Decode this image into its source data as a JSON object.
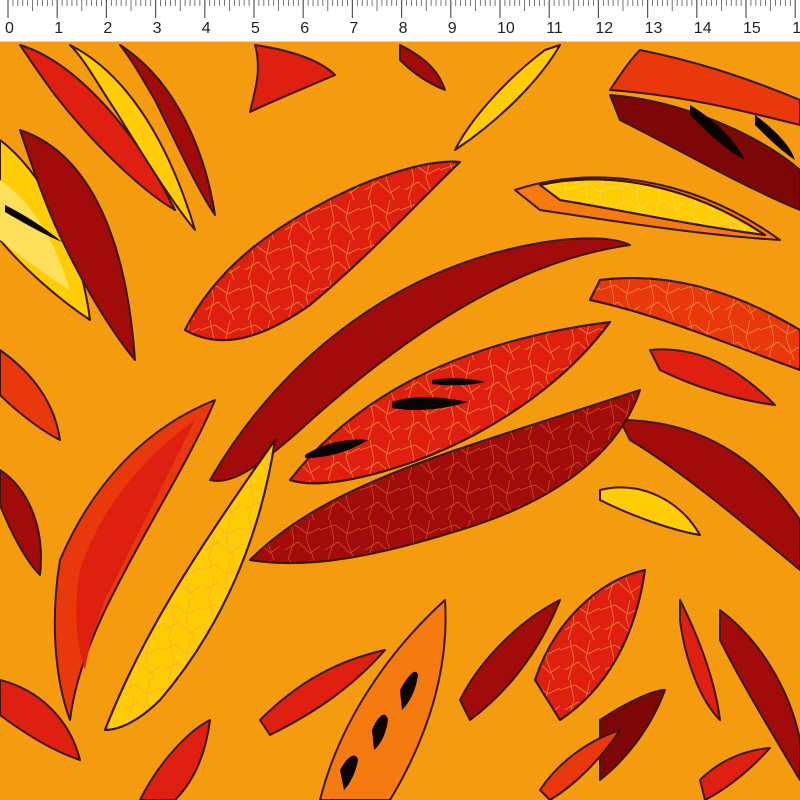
{
  "ruler": {
    "labels": [
      "0",
      "1",
      "2",
      "3",
      "4",
      "5",
      "6",
      "7",
      "8",
      "9",
      "10",
      "11",
      "12",
      "13",
      "14",
      "15",
      "1"
    ]
  },
  "palette": {
    "base_orange": "#f59b10",
    "deep_orange": "#f57a10",
    "red": "#df1f10",
    "bright_red": "#e8380c",
    "maroon": "#a10b0a",
    "dark_maroon": "#7d0707",
    "yellow": "#ffcc05",
    "light_yellow": "#ffe05a",
    "black": "#0a0503",
    "outline": "#3a1702"
  },
  "pattern": {
    "motif": "flame-leaves",
    "slits": "black"
  }
}
